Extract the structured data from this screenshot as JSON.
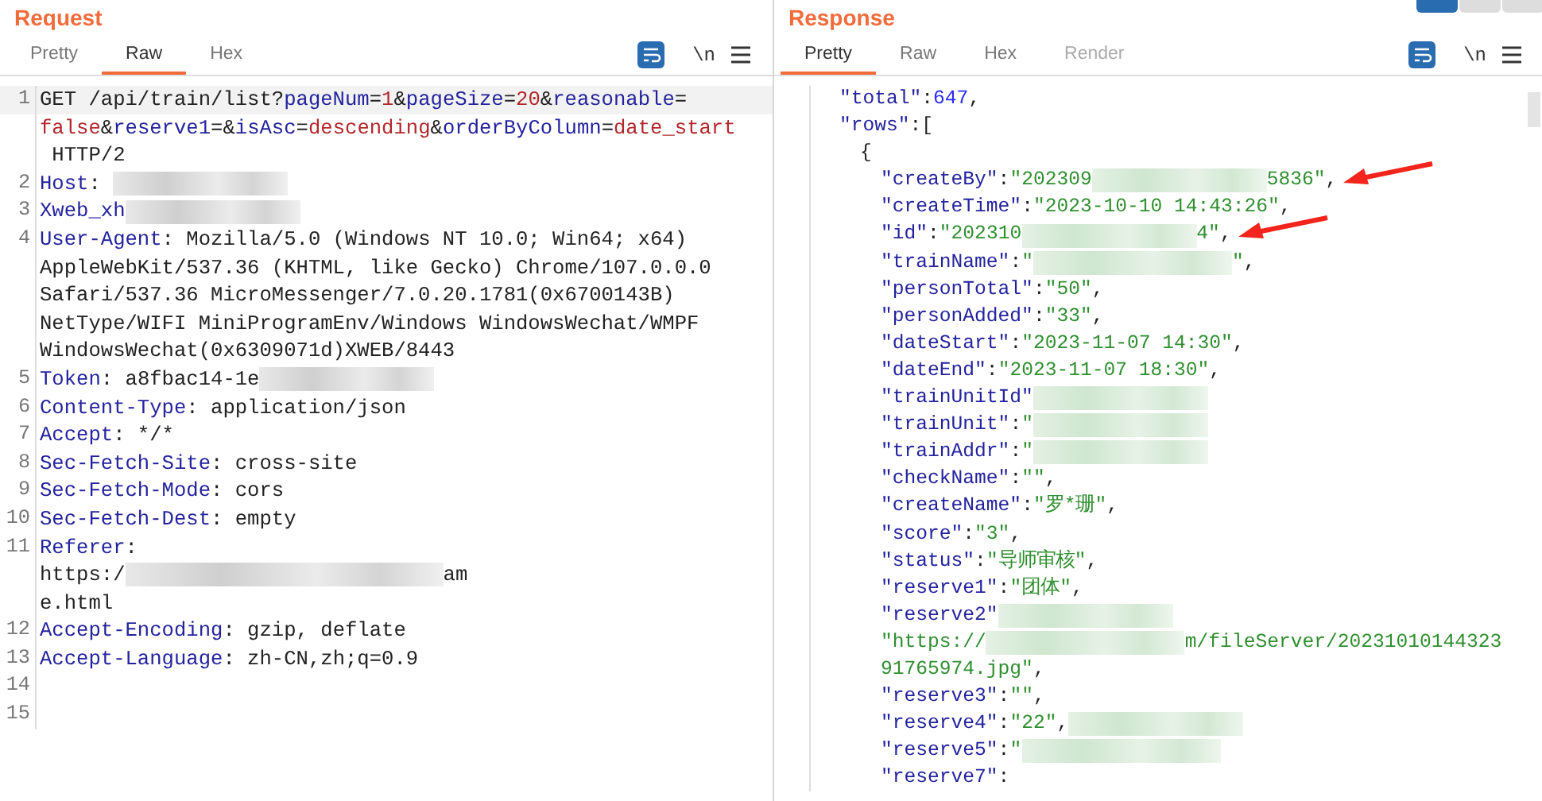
{
  "request": {
    "title": "Request",
    "tabs": [
      {
        "label": "Pretty",
        "selected": false
      },
      {
        "label": "Raw",
        "selected": true
      },
      {
        "label": "Hex",
        "selected": false
      }
    ],
    "toolbar": {
      "newline": "\\n"
    },
    "lines": [
      {
        "number": "1",
        "highlighted": true,
        "parts": [
          {
            "kind": "plain",
            "text": "GET /api/train/list?"
          },
          {
            "kind": "key",
            "text": "pageNum"
          },
          {
            "kind": "plain",
            "text": "="
          },
          {
            "kind": "value",
            "text": "1"
          },
          {
            "kind": "plain",
            "text": "&"
          },
          {
            "kind": "key",
            "text": "pageSize"
          },
          {
            "kind": "plain",
            "text": "="
          },
          {
            "kind": "value",
            "text": "20"
          },
          {
            "kind": "plain",
            "text": "&"
          },
          {
            "kind": "key",
            "text": "reasonable"
          },
          {
            "kind": "plain",
            "text": "="
          }
        ]
      },
      {
        "parts": [
          {
            "kind": "value",
            "text": "false"
          },
          {
            "kind": "plain",
            "text": "&"
          },
          {
            "kind": "key",
            "text": "reserve1"
          },
          {
            "kind": "plain",
            "text": "=&"
          },
          {
            "kind": "key",
            "text": "isAsc"
          },
          {
            "kind": "plain",
            "text": "="
          },
          {
            "kind": "value",
            "text": "descending"
          },
          {
            "kind": "plain",
            "text": "&"
          },
          {
            "kind": "key",
            "text": "orderByColumn"
          },
          {
            "kind": "plain",
            "text": "="
          },
          {
            "kind": "value",
            "text": "date_start"
          }
        ]
      },
      {
        "parts": [
          {
            "kind": "plain",
            "text": " HTTP/2"
          }
        ]
      },
      {
        "number": "2",
        "parts": [
          {
            "kind": "key",
            "text": "Host"
          },
          {
            "kind": "plain",
            "text": ": "
          },
          {
            "kind": "redacted"
          }
        ]
      },
      {
        "number": "3",
        "parts": [
          {
            "kind": "key",
            "text": "Xweb_xh"
          },
          {
            "kind": "redacted"
          }
        ]
      },
      {
        "number": "4",
        "parts": [
          {
            "kind": "key",
            "text": "User-Agent"
          },
          {
            "kind": "plain",
            "text": ": Mozilla/5.0 (Windows NT 10.0; Win64; x64)"
          }
        ]
      },
      {
        "parts": [
          {
            "kind": "plain",
            "text": "AppleWebKit/537.36 (KHTML, like Gecko) Chrome/107.0.0.0"
          }
        ]
      },
      {
        "parts": [
          {
            "kind": "plain",
            "text": "Safari/537.36 MicroMessenger/7.0.20.1781(0x6700143B)"
          }
        ]
      },
      {
        "parts": [
          {
            "kind": "plain",
            "text": "NetType/WIFI MiniProgramEnv/Windows WindowsWechat/WMPF"
          }
        ]
      },
      {
        "parts": [
          {
            "kind": "plain",
            "text": "WindowsWechat(0x6309071d)XWEB/8443"
          }
        ]
      },
      {
        "number": "5",
        "parts": [
          {
            "kind": "key",
            "text": "Token"
          },
          {
            "kind": "plain",
            "text": ": a8fbac14-1e"
          },
          {
            "kind": "redacted"
          }
        ]
      },
      {
        "number": "6",
        "parts": [
          {
            "kind": "key",
            "text": "Content-Type"
          },
          {
            "kind": "plain",
            "text": ": application/json"
          }
        ]
      },
      {
        "number": "7",
        "parts": [
          {
            "kind": "key",
            "text": "Accept"
          },
          {
            "kind": "plain",
            "text": ": */*"
          }
        ]
      },
      {
        "number": "8",
        "parts": [
          {
            "kind": "key",
            "text": "Sec-Fetch-Site"
          },
          {
            "kind": "plain",
            "text": ": cross-site"
          }
        ]
      },
      {
        "number": "9",
        "parts": [
          {
            "kind": "key",
            "text": "Sec-Fetch-Mode"
          },
          {
            "kind": "plain",
            "text": ": cors"
          }
        ]
      },
      {
        "number": "10",
        "parts": [
          {
            "kind": "key",
            "text": "Sec-Fetch-Dest"
          },
          {
            "kind": "plain",
            "text": ": empty"
          }
        ]
      },
      {
        "number": "11",
        "parts": [
          {
            "kind": "key",
            "text": "Referer"
          },
          {
            "kind": "plain",
            "text": ":"
          }
        ]
      },
      {
        "parts": [
          {
            "kind": "plain",
            "text": "https:/"
          },
          {
            "kind": "redacted",
            "wide": true
          },
          {
            "kind": "plain",
            "text": "am"
          }
        ]
      },
      {
        "parts": [
          {
            "kind": "plain",
            "text": "e.html"
          }
        ]
      },
      {
        "number": "12",
        "parts": [
          {
            "kind": "key",
            "text": "Accept-Encoding"
          },
          {
            "kind": "plain",
            "text": ": gzip, deflate"
          }
        ]
      },
      {
        "number": "13",
        "parts": [
          {
            "kind": "key",
            "text": "Accept-Language"
          },
          {
            "kind": "plain",
            "text": ": zh-CN,zh;q=0.9"
          }
        ]
      },
      {
        "number": "14"
      },
      {
        "number": "15"
      }
    ]
  },
  "response": {
    "title": "Response",
    "tabs": [
      {
        "label": "Pretty",
        "selected": true,
        "disabled": false
      },
      {
        "label": "Raw",
        "selected": false,
        "disabled": false
      },
      {
        "label": "Hex",
        "selected": false,
        "disabled": false
      },
      {
        "label": "Render",
        "selected": false,
        "disabled": true
      }
    ],
    "toolbar": {
      "newline": "\\n"
    },
    "lines": [
      {
        "parts": [
          {
            "kind": "key",
            "text": "\"total\""
          },
          {
            "kind": "plain",
            "text": ":"
          },
          {
            "kind": "number",
            "text": "647"
          },
          {
            "kind": "plain",
            "text": ","
          }
        ]
      },
      {
        "parts": [
          {
            "kind": "key",
            "text": "\"rows\""
          },
          {
            "kind": "plain",
            "text": ":["
          }
        ],
        "children": [
          {
            "parts": [
              {
                "kind": "plain",
                "text": "{"
              }
            ],
            "children": [
              {
                "parts": [
                  {
                    "kind": "key",
                    "text": "\"createBy\""
                  },
                  {
                    "kind": "plain",
                    "text": ":"
                  },
                  {
                    "kind": "string",
                    "text": "\"202309"
                  },
                  {
                    "kind": "redacted"
                  },
                  {
                    "kind": "string",
                    "text": "5836\""
                  },
                  {
                    "kind": "plain",
                    "text": ","
                  }
                ],
                "annotated": true
              },
              {
                "parts": [
                  {
                    "kind": "key",
                    "text": "\"createTime\""
                  },
                  {
                    "kind": "plain",
                    "text": ":"
                  },
                  {
                    "kind": "string",
                    "text": "\"2023-10-10 14:43:26\""
                  },
                  {
                    "kind": "plain",
                    "text": ","
                  }
                ]
              },
              {
                "parts": [
                  {
                    "kind": "key",
                    "text": "\"id\""
                  },
                  {
                    "kind": "plain",
                    "text": ":"
                  },
                  {
                    "kind": "string",
                    "text": "\"202310"
                  },
                  {
                    "kind": "redacted"
                  },
                  {
                    "kind": "string",
                    "text": "4\""
                  },
                  {
                    "kind": "plain",
                    "text": ","
                  }
                ],
                "annotated": true
              },
              {
                "parts": [
                  {
                    "kind": "key",
                    "text": "\"trainName\""
                  },
                  {
                    "kind": "plain",
                    "text": ":"
                  },
                  {
                    "kind": "string",
                    "text": "\""
                  },
                  {
                    "kind": "redacted",
                    "wide": true
                  },
                  {
                    "kind": "string",
                    "text": "\""
                  },
                  {
                    "kind": "plain",
                    "text": ","
                  }
                ]
              },
              {
                "parts": [
                  {
                    "kind": "key",
                    "text": "\"personTotal\""
                  },
                  {
                    "kind": "plain",
                    "text": ":"
                  },
                  {
                    "kind": "string",
                    "text": "\"50\""
                  },
                  {
                    "kind": "plain",
                    "text": ","
                  }
                ]
              },
              {
                "parts": [
                  {
                    "kind": "key",
                    "text": "\"personAdded\""
                  },
                  {
                    "kind": "plain",
                    "text": ":"
                  },
                  {
                    "kind": "string",
                    "text": "\"33\""
                  },
                  {
                    "kind": "plain",
                    "text": ","
                  }
                ]
              },
              {
                "parts": [
                  {
                    "kind": "key",
                    "text": "\"dateStart\""
                  },
                  {
                    "kind": "plain",
                    "text": ":"
                  },
                  {
                    "kind": "string",
                    "text": "\"2023-11-07 14:30\""
                  },
                  {
                    "kind": "plain",
                    "text": ","
                  }
                ]
              },
              {
                "parts": [
                  {
                    "kind": "key",
                    "text": "\"dateEnd\""
                  },
                  {
                    "kind": "plain",
                    "text": ":"
                  },
                  {
                    "kind": "string",
                    "text": "\"2023-11-07 18:30\""
                  },
                  {
                    "kind": "plain",
                    "text": ","
                  }
                ]
              },
              {
                "parts": [
                  {
                    "kind": "key",
                    "text": "\"trainUnitId\""
                  },
                  {
                    "kind": "redacted"
                  }
                ]
              },
              {
                "parts": [
                  {
                    "kind": "key",
                    "text": "\"trainUnit\""
                  },
                  {
                    "kind": "plain",
                    "text": ":"
                  },
                  {
                    "kind": "string",
                    "text": "\""
                  },
                  {
                    "kind": "redacted"
                  }
                ]
              },
              {
                "parts": [
                  {
                    "kind": "key",
                    "text": "\"trainAddr\""
                  },
                  {
                    "kind": "plain",
                    "text": ":"
                  },
                  {
                    "kind": "string",
                    "text": "\""
                  },
                  {
                    "kind": "redacted"
                  }
                ]
              },
              {
                "parts": [
                  {
                    "kind": "key",
                    "text": "\"checkName\""
                  },
                  {
                    "kind": "plain",
                    "text": ":"
                  },
                  {
                    "kind": "string",
                    "text": "\"\""
                  },
                  {
                    "kind": "plain",
                    "text": ","
                  }
                ]
              },
              {
                "parts": [
                  {
                    "kind": "key",
                    "text": "\"createName\""
                  },
                  {
                    "kind": "plain",
                    "text": ":"
                  },
                  {
                    "kind": "string",
                    "text": "\"罗*珊\""
                  },
                  {
                    "kind": "plain",
                    "text": ","
                  }
                ]
              },
              {
                "parts": [
                  {
                    "kind": "key",
                    "text": "\"score\""
                  },
                  {
                    "kind": "plain",
                    "text": ":"
                  },
                  {
                    "kind": "string",
                    "text": "\"3\""
                  },
                  {
                    "kind": "plain",
                    "text": ","
                  }
                ]
              },
              {
                "parts": [
                  {
                    "kind": "key",
                    "text": "\"status\""
                  },
                  {
                    "kind": "plain",
                    "text": ":"
                  },
                  {
                    "kind": "string",
                    "text": "\"导师审核\""
                  },
                  {
                    "kind": "plain",
                    "text": ","
                  }
                ]
              },
              {
                "parts": [
                  {
                    "kind": "key",
                    "text": "\"reserve1\""
                  },
                  {
                    "kind": "plain",
                    "text": ":"
                  },
                  {
                    "kind": "string",
                    "text": "\"团体\""
                  },
                  {
                    "kind": "plain",
                    "text": ","
                  }
                ]
              },
              {
                "parts": [
                  {
                    "kind": "key",
                    "text": "\"reserve2\""
                  },
                  {
                    "kind": "redacted"
                  }
                ]
              },
              {
                "parts": [
                  {
                    "kind": "string",
                    "text": "\"https://"
                  },
                  {
                    "kind": "redacted",
                    "wide": true
                  },
                  {
                    "kind": "string",
                    "text": "m/fileServer/20231010144323"
                  }
                ]
              },
              {
                "parts": [
                  {
                    "kind": "string",
                    "text": "91765974.jpg\""
                  },
                  {
                    "kind": "plain",
                    "text": ","
                  }
                ]
              },
              {
                "parts": [
                  {
                    "kind": "key",
                    "text": "\"reserve3\""
                  },
                  {
                    "kind": "plain",
                    "text": ":"
                  },
                  {
                    "kind": "string",
                    "text": "\"\""
                  },
                  {
                    "kind": "plain",
                    "text": ","
                  }
                ]
              },
              {
                "parts": [
                  {
                    "kind": "key",
                    "text": "\"reserve4\""
                  },
                  {
                    "kind": "plain",
                    "text": ":"
                  },
                  {
                    "kind": "string",
                    "text": "\"22\""
                  },
                  {
                    "kind": "plain",
                    "text": ","
                  },
                  {
                    "kind": "redacted"
                  }
                ]
              },
              {
                "parts": [
                  {
                    "kind": "key",
                    "text": "\"reserve5\""
                  },
                  {
                    "kind": "plain",
                    "text": ":"
                  },
                  {
                    "kind": "string",
                    "text": "\""
                  },
                  {
                    "kind": "redacted",
                    "wide": true
                  }
                ]
              },
              {
                "parts": [
                  {
                    "kind": "key",
                    "text": "\"reserve7\""
                  },
                  {
                    "kind": "plain",
                    "text": ":"
                  }
                ]
              }
            ]
          }
        ]
      }
    ]
  }
}
